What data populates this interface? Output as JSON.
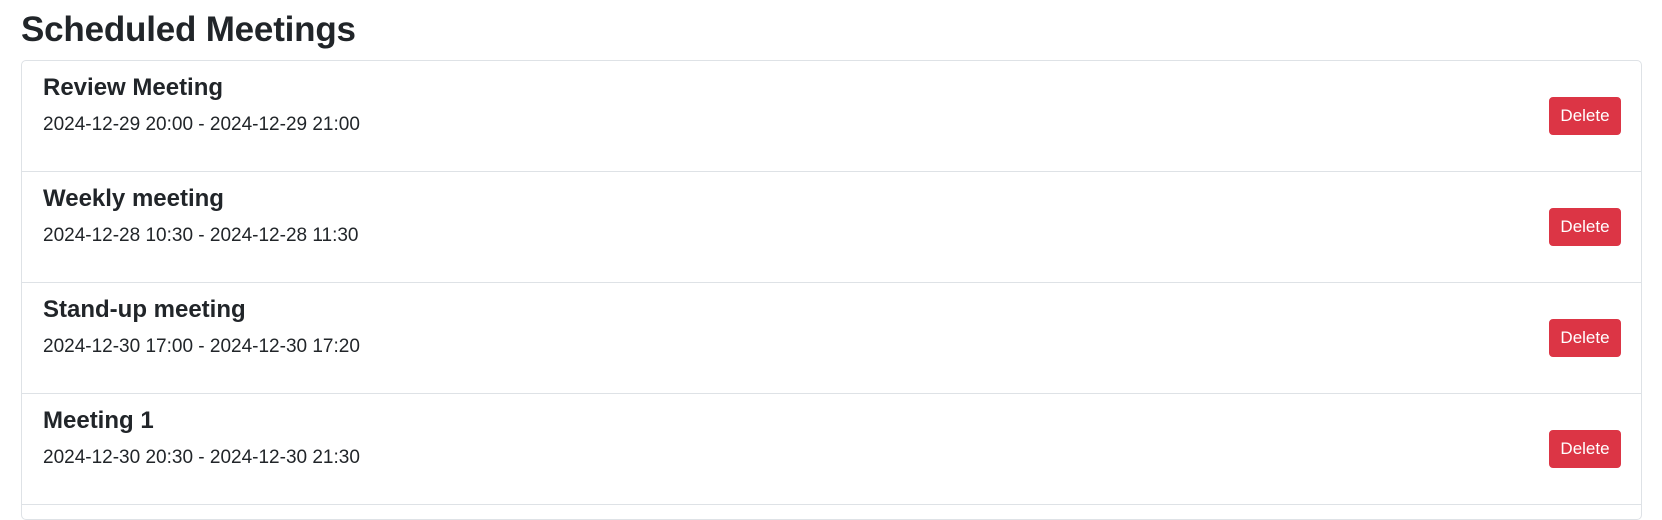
{
  "page": {
    "title": "Scheduled Meetings"
  },
  "meetings": [
    {
      "title": "Review Meeting",
      "time": "2024-12-29 20:00 - 2024-12-29 21:00",
      "delete_label": "Delete"
    },
    {
      "title": "Weekly meeting",
      "time": "2024-12-28 10:30 - 2024-12-28 11:30",
      "delete_label": "Delete"
    },
    {
      "title": "Stand-up meeting",
      "time": "2024-12-30 17:00 - 2024-12-30 17:20",
      "delete_label": "Delete"
    },
    {
      "title": "Meeting 1",
      "time": "2024-12-30 20:30 - 2024-12-30 21:30",
      "delete_label": "Delete"
    }
  ],
  "colors": {
    "delete_button": "#dc3545",
    "text": "#212529",
    "border": "#dee2e6"
  }
}
